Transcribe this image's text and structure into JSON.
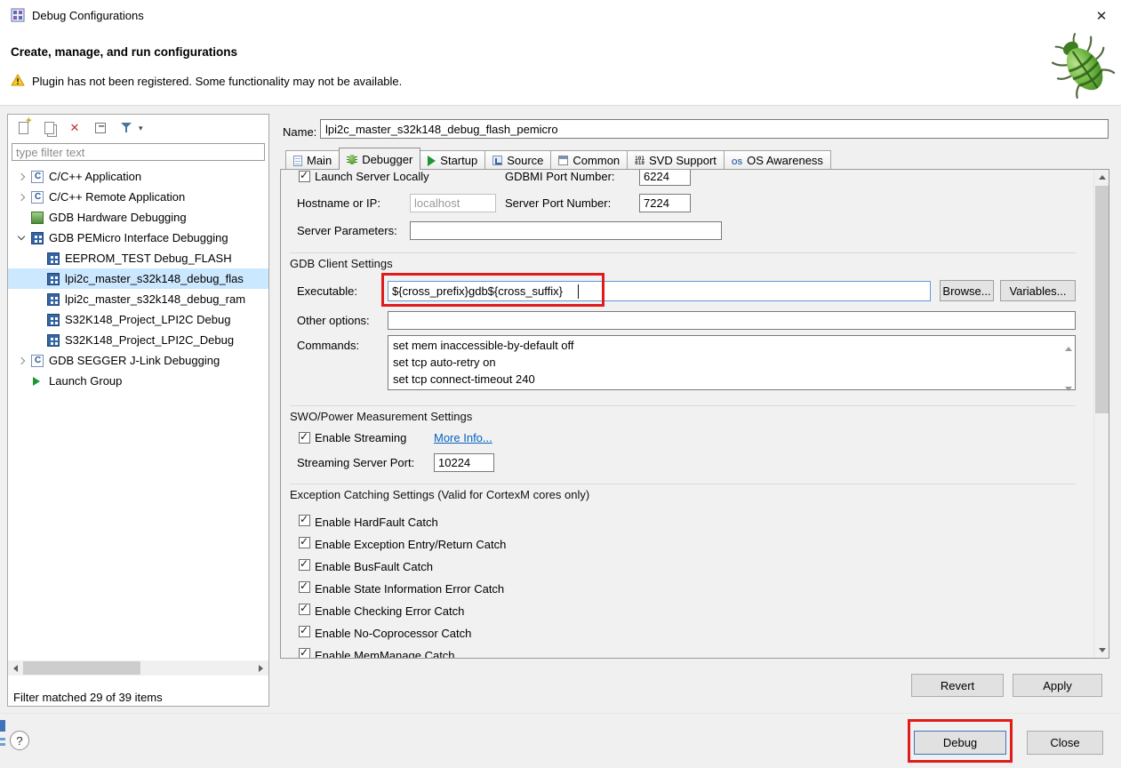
{
  "window": {
    "title": "Debug Configurations"
  },
  "header": {
    "title": "Create, manage, and run configurations",
    "warning": "Plugin has not been registered. Some functionality may not be available."
  },
  "icons": {
    "close": "✕",
    "help": "?",
    "check": "✓",
    "names": [
      "debug-configurations-icon",
      "warning-icon",
      "bug-banner-icon",
      "new-config-icon",
      "duplicate-config-icon",
      "delete-config-icon",
      "collapse-all-icon",
      "filter-menu-icon",
      "dropdown-caret-icon",
      "chevron-right-icon",
      "chevron-down-icon",
      "c-application-icon",
      "gdb-hardware-icon",
      "pemicro-config-icon",
      "launch-group-icon",
      "page-icon",
      "bug-icon",
      "play-icon",
      "source-icon",
      "common-icon",
      "svd-icon",
      "os-awareness-icon"
    ]
  },
  "colors": {
    "annotation_red": "#e01b1b",
    "selection_blue": "#cce8ff",
    "link_blue": "#0563c1",
    "bug_green": "#4c9a2a"
  },
  "sidebar": {
    "filter_placeholder": "type filter text",
    "status": "Filter matched 29 of 39 items",
    "tree": [
      {
        "label": "C/C++ Application",
        "level": 0,
        "state": "collapsed",
        "selected": false
      },
      {
        "label": "C/C++ Remote Application",
        "level": 0,
        "state": "collapsed",
        "selected": false
      },
      {
        "label": "GDB Hardware Debugging",
        "level": 0,
        "state": "none",
        "selected": false
      },
      {
        "label": "GDB PEMicro Interface Debugging",
        "level": 0,
        "state": "expanded",
        "selected": false
      },
      {
        "label": "EEPROM_TEST Debug_FLASH",
        "level": 1,
        "selected": false
      },
      {
        "label": "lpi2c_master_s32k148_debug_flas",
        "level": 1,
        "selected": true
      },
      {
        "label": "lpi2c_master_s32k148_debug_ram",
        "level": 1,
        "selected": false
      },
      {
        "label": "S32K148_Project_LPI2C Debug",
        "level": 1,
        "selected": false
      },
      {
        "label": "S32K148_Project_LPI2C_Debug",
        "level": 1,
        "selected": false
      },
      {
        "label": "GDB SEGGER J-Link Debugging",
        "level": 0,
        "state": "collapsed",
        "selected": false
      },
      {
        "label": "Launch Group",
        "level": 0,
        "state": "none",
        "selected": false
      }
    ]
  },
  "main": {
    "name_label": "Name:",
    "name_value": "lpi2c_master_s32k148_debug_flash_pemicro",
    "tabs": [
      {
        "label": "Main",
        "selected": false
      },
      {
        "label": "Debugger",
        "selected": true
      },
      {
        "label": "Startup",
        "selected": false
      },
      {
        "label": "Source",
        "selected": false
      },
      {
        "label": "Common",
        "selected": false
      },
      {
        "label": "SVD Support",
        "selected": false
      },
      {
        "label": "OS Awareness",
        "selected": false
      }
    ],
    "form": {
      "launch_server_label": "Launch Server Locally",
      "launch_server_checked": true,
      "gdbmi_port_label": "GDBMI Port Number:",
      "gdbmi_port_value": "6224",
      "hostname_label": "Hostname or IP:",
      "hostname_placeholder": "localhost",
      "server_port_label": "Server Port Number:",
      "server_port_value": "7224",
      "server_params_label": "Server Parameters:",
      "server_params_value": "",
      "gdb_client_group": "GDB Client Settings",
      "executable_label": "Executable:",
      "executable_value": "${cross_prefix}gdb${cross_suffix}",
      "browse_button": "Browse...",
      "variables_button": "Variables...",
      "other_options_label": "Other options:",
      "other_options_value": "",
      "commands_label": "Commands:",
      "commands_value": "set mem inaccessible-by-default off\nset tcp auto-retry on\nset tcp connect-timeout 240",
      "swo_group": "SWO/Power Measurement Settings",
      "enable_streaming_label": "Enable Streaming",
      "enable_streaming_checked": true,
      "more_info_link": "More Info...",
      "streaming_port_label": "Streaming Server Port:",
      "streaming_port_value": "10224",
      "exception_group": "Exception Catching Settings (Valid for CortexM cores only)",
      "exception_checkboxes": [
        {
          "label": "Enable HardFault Catch",
          "checked": true
        },
        {
          "label": "Enable Exception Entry/Return Catch",
          "checked": true
        },
        {
          "label": "Enable BusFault Catch",
          "checked": true
        },
        {
          "label": "Enable State Information Error Catch",
          "checked": true
        },
        {
          "label": "Enable Checking Error Catch",
          "checked": true
        },
        {
          "label": "Enable No-Coprocessor Catch",
          "checked": true
        },
        {
          "label": "Enable MemManage Catch",
          "checked": true
        }
      ]
    },
    "revert_button": "Revert",
    "apply_button": "Apply"
  },
  "footer": {
    "debug_button": "Debug",
    "close_button": "Close"
  }
}
